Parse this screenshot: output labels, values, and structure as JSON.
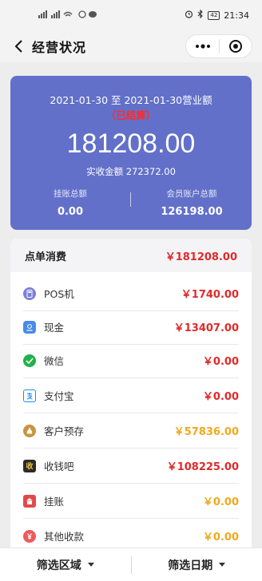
{
  "status_bar": {
    "left_text": "HD 5G HD",
    "battery": "42",
    "time": "21:34"
  },
  "nav": {
    "title": "经营状况",
    "icons": [
      "back-icon",
      "more-icon",
      "close-icon"
    ]
  },
  "hero": {
    "range_text": "2021-01-30 至 2021-01-30营业额",
    "status_text": "（已结算）",
    "total_amount": "181208.00",
    "actual_received": "实收金额 272372.00",
    "left_label": "挂账总额",
    "left_value": "0.00",
    "right_label": "会员账户总额",
    "right_value": "126198.00",
    "background_color": "#6270c9"
  },
  "list": {
    "header_title": "点单消费",
    "header_value": "￥181208.00",
    "rows": [
      {
        "name": "POS机",
        "amount": "￥1740.00",
        "icon": "pos-icon",
        "icon_color": "#7b7fd8",
        "color": "red"
      },
      {
        "name": "现金",
        "amount": "￥13407.00",
        "icon": "cash-icon",
        "icon_color": "#4a8be6",
        "color": "red"
      },
      {
        "name": "微信",
        "amount": "￥0.00",
        "icon": "wechat-icon",
        "icon_color": "#22b14c",
        "color": "red"
      },
      {
        "name": "支付宝",
        "amount": "￥0.00",
        "icon": "alipay-icon",
        "icon_color": "#1a8ef0",
        "color": "red"
      },
      {
        "name": "客户预存",
        "amount": "￥57836.00",
        "icon": "deposit-icon",
        "icon_color": "#c99440",
        "color": "orange"
      },
      {
        "name": "收钱吧",
        "amount": "￥108225.00",
        "icon": "shouqianba-icon",
        "icon_color": "#2b2b2b",
        "color": "red"
      },
      {
        "name": "挂账",
        "amount": "￥0.00",
        "icon": "credit-icon",
        "icon_color": "#e24a4a",
        "color": "orange"
      },
      {
        "name": "其他收款",
        "amount": "￥0.00",
        "icon": "other-payment-icon",
        "icon_color": "#ef5a5a",
        "color": "orange"
      }
    ]
  },
  "footer": {
    "tab_area": "筛选区域",
    "tab_date": "筛选日期"
  },
  "colors": {
    "accent_red": "#e02a2a",
    "accent_orange": "#f2a81d"
  }
}
